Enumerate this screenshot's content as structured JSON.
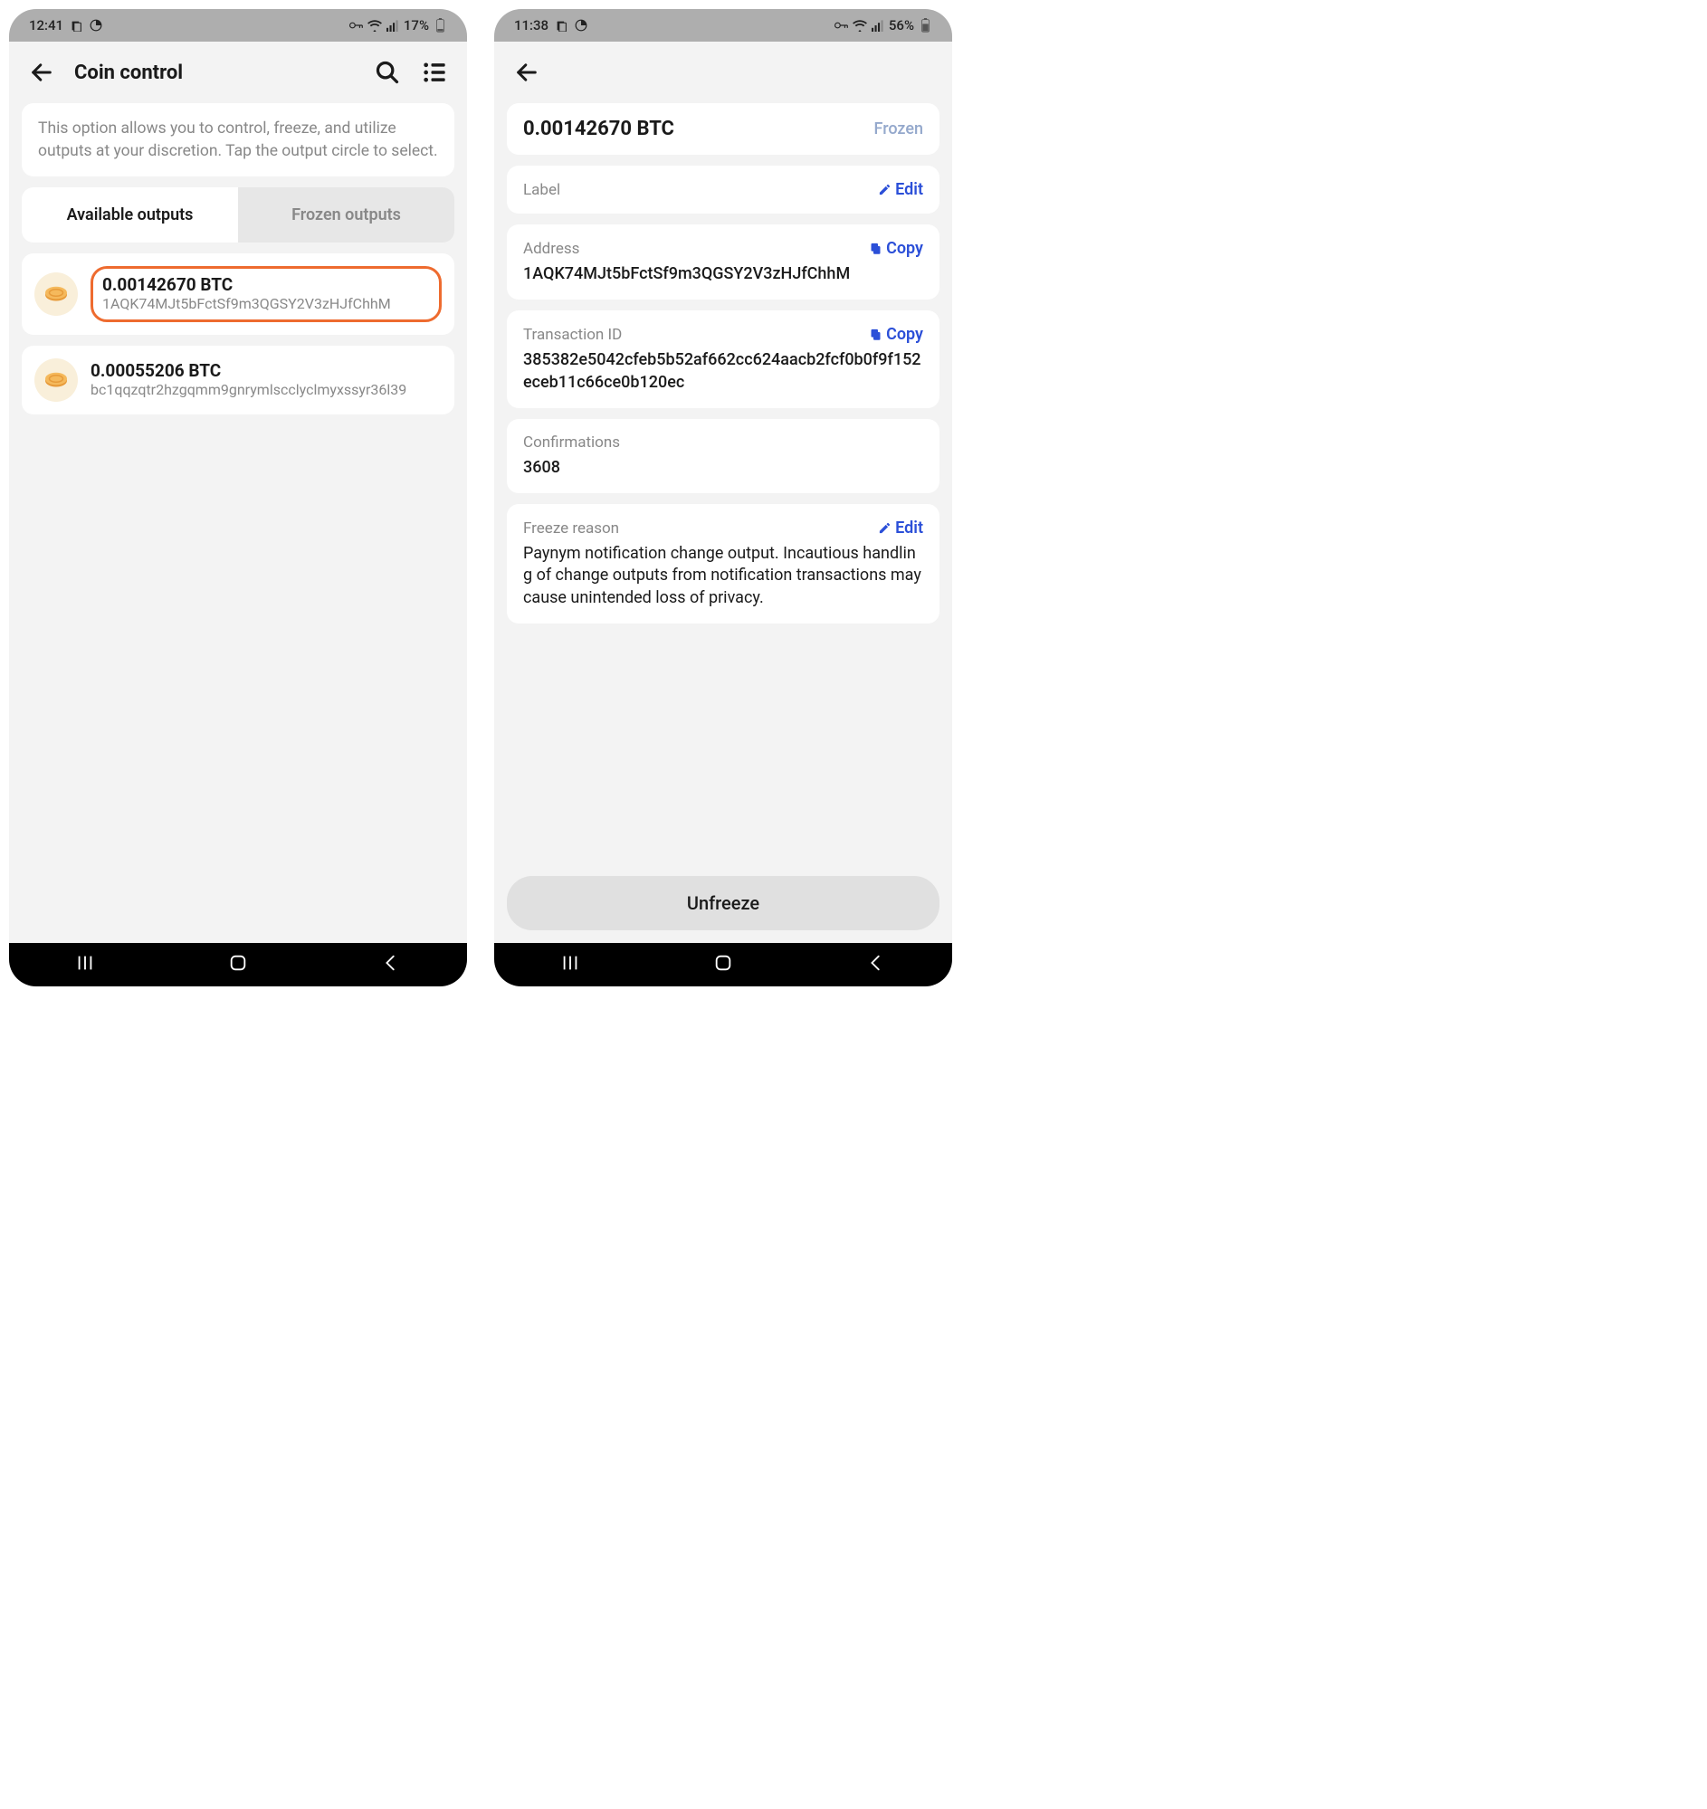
{
  "left": {
    "status": {
      "time": "12:41",
      "battery": "17%"
    },
    "header": {
      "title": "Coin control"
    },
    "info": "This option allows you to control, freeze, and utilize outputs at your discretion. Tap the output circle to select.",
    "tabs": {
      "available": "Available outputs",
      "frozen": "Frozen outputs"
    },
    "utxos": [
      {
        "amount": "0.00142670 BTC",
        "address": "1AQK74MJt5bFctSf9m3QGSY2V3zHJfChhM"
      },
      {
        "amount": "0.00055206 BTC",
        "address": "bc1qqzqtr2hzgqmm9gnrymlscclyclmyxssyr36l39"
      }
    ]
  },
  "right": {
    "status": {
      "time": "11:38",
      "battery": "56%"
    },
    "amount": "0.00142670 BTC",
    "frozen_label": "Frozen",
    "sections": {
      "label": {
        "title": "Label",
        "action": "Edit"
      },
      "address": {
        "title": "Address",
        "action": "Copy",
        "value": "1AQK74MJt5bFctSf9m3QGSY2V3zHJfChhM"
      },
      "txid": {
        "title": "Transaction ID",
        "action": "Copy",
        "value": "385382e5042cfeb5b52af662cc624aacb2fcf0b0f9f152eceb11c66ce0b120ec"
      },
      "confirmations": {
        "title": "Confirmations",
        "value": "3608"
      },
      "freeze_reason": {
        "title": "Freeze reason",
        "action": "Edit",
        "value": "Paynym notification change output. Incautious handling of change outputs from notification transactions may cause unintended loss of privacy."
      }
    },
    "unfreeze": "Unfreeze"
  }
}
